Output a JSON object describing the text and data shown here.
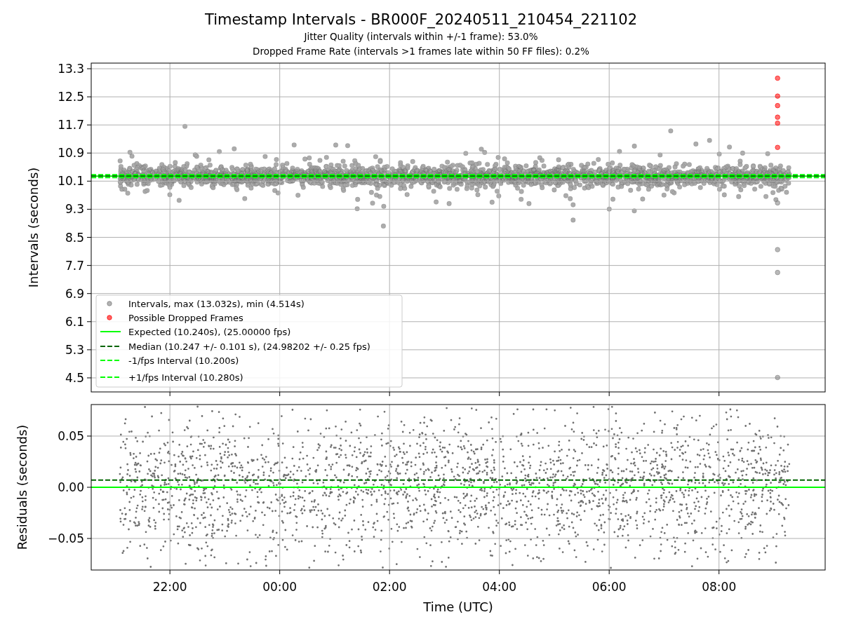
{
  "figure": {
    "title": "Timestamp Intervals - BR000F_20240511_210454_221102",
    "subtitles": [
      "Jitter Quality (intervals within +/-1 frame): 53.0%",
      "Dropped Frame Rate (intervals >1 frames late within 50 FF files): 0.2%"
    ]
  },
  "intervals_plot": {
    "chart_data": {
      "type": "scatter",
      "ylabel": "Intervals (seconds)",
      "xlim": [
        "2024-05-11T20:34",
        "2024-05-12T09:56"
      ],
      "ylim": [
        4.1,
        13.46
      ],
      "grid": true,
      "legend": true,
      "yticks": [
        {
          "value": 13.3,
          "label": "13.3"
        },
        {
          "value": 12.5,
          "label": "12.5"
        },
        {
          "value": 11.7,
          "label": "11.7"
        },
        {
          "value": 10.9,
          "label": "10.9"
        },
        {
          "value": 10.1,
          "label": "10.1"
        },
        {
          "value": 9.3,
          "label": "9.3"
        },
        {
          "value": 8.5,
          "label": "8.5"
        },
        {
          "value": 7.7,
          "label": "7.7"
        },
        {
          "value": 6.9,
          "label": "6.9"
        },
        {
          "value": 6.1,
          "label": "6.1"
        },
        {
          "value": 5.3,
          "label": "5.3"
        },
        {
          "value": 4.5,
          "label": "4.5"
        }
      ],
      "x": [
        "2024-05-12T09:04",
        "2024-05-12T09:04",
        "2024-05-12T09:04",
        "2024-05-12T09:04",
        "2024-05-12T09:04",
        "2024-05-12T09:04",
        "2024-05-12T09:04",
        "2024-05-12T09:04",
        "2024-05-12T09:04",
        "2024-05-12T09:04"
      ],
      "series": [
        {
          "name": "Intervals, max (13.032s), min (4.514s)",
          "color": "#808080",
          "values": [
            null,
            null,
            null,
            null,
            null,
            null,
            9.48,
            8.15,
            7.5,
            4.51
          ]
        },
        {
          "name": "Possible Dropped Frames",
          "color": "#ff0000",
          "values": [
            13.03,
            12.52,
            12.25,
            11.92,
            11.75,
            11.06,
            null,
            null,
            null,
            null
          ]
        }
      ],
      "ref_lines": [
        {
          "axis": "y",
          "value": 10.24,
          "label": "Expected (10.240s), (25.00000 fps)",
          "color": "#00ff00"
        },
        {
          "axis": "y",
          "value": 10.247,
          "label": "Median (10.247 +/- 0.101 s), (24.98202 +/- 0.25 fps)",
          "color": "#006400"
        },
        {
          "axis": "y",
          "value": 10.2,
          "label": "-1/fps Interval (10.200s)",
          "color": "#00ff00"
        },
        {
          "axis": "y",
          "value": 10.28,
          "label": "+1/fps Interval (10.280s)",
          "color": "#00ff00"
        }
      ]
    }
  },
  "residuals_plot": {
    "chart_data": {
      "type": "scatter",
      "xlabel": "Time (UTC)",
      "ylabel": "Residuals (seconds)",
      "xlim": [
        "2024-05-11T20:34",
        "2024-05-12T09:56"
      ],
      "ylim": [
        -0.0808,
        0.0808
      ],
      "grid": true,
      "xticks": [
        {
          "value": "2024-05-11T22:00",
          "label": "22:00"
        },
        {
          "value": "2024-05-12T00:00",
          "label": "00:00"
        },
        {
          "value": "2024-05-12T02:00",
          "label": "02:00"
        },
        {
          "value": "2024-05-12T04:00",
          "label": "04:00"
        },
        {
          "value": "2024-05-12T06:00",
          "label": "06:00"
        },
        {
          "value": "2024-05-12T08:00",
          "label": "08:00"
        }
      ],
      "yticks": [
        {
          "value": 0.05,
          "label": "0.05"
        },
        {
          "value": 0,
          "label": "0.00"
        },
        {
          "value": -0.05,
          "label": "−0.05"
        }
      ],
      "ref_lines": [
        {
          "axis": "y",
          "value": 0,
          "color": "#00ff00"
        },
        {
          "axis": "y",
          "value": 0.007,
          "color": "#006400"
        }
      ]
    }
  }
}
